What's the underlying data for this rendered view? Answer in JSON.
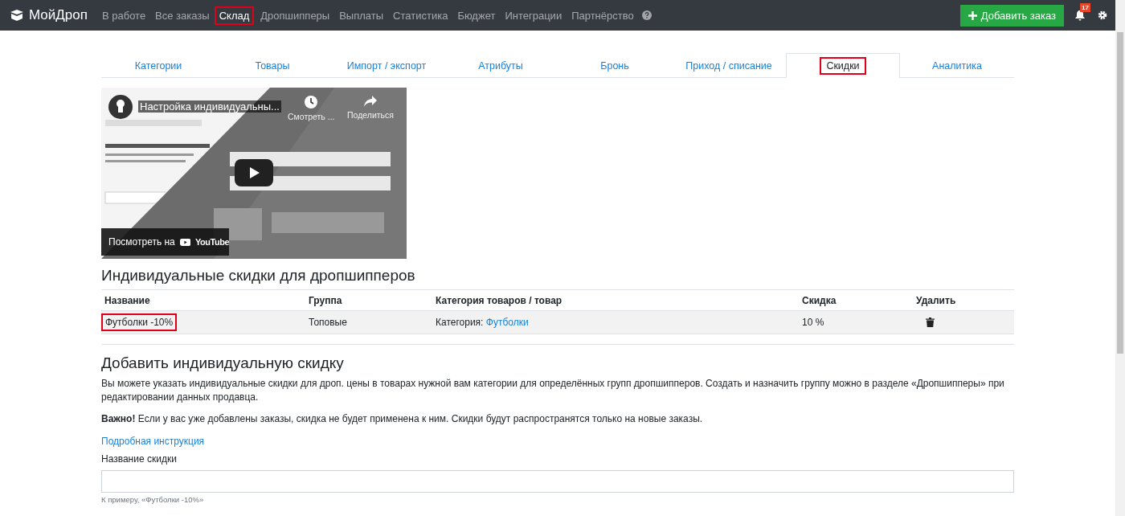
{
  "navbar": {
    "brand": "МойДроп",
    "items": [
      {
        "label": "В работе",
        "selected": false,
        "highlighted": false
      },
      {
        "label": "Все заказы",
        "selected": false,
        "highlighted": false
      },
      {
        "label": "Склад",
        "selected": true,
        "highlighted": true
      },
      {
        "label": "Дропшипперы",
        "selected": false,
        "highlighted": false
      },
      {
        "label": "Выплаты",
        "selected": false,
        "highlighted": false
      },
      {
        "label": "Статистика",
        "selected": false,
        "highlighted": false
      },
      {
        "label": "Бюджет",
        "selected": false,
        "highlighted": false
      },
      {
        "label": "Интеграции",
        "selected": false,
        "highlighted": false
      },
      {
        "label": "Партнёрство",
        "selected": false,
        "highlighted": false
      }
    ],
    "add_button": "Добавить заказ",
    "notifications_count": "17"
  },
  "tabs": [
    {
      "label": "Категории",
      "selected": false,
      "highlighted": false
    },
    {
      "label": "Товары",
      "selected": false,
      "highlighted": false
    },
    {
      "label": "Импорт / экспорт",
      "selected": false,
      "highlighted": false
    },
    {
      "label": "Атрибуты",
      "selected": false,
      "highlighted": false
    },
    {
      "label": "Бронь",
      "selected": false,
      "highlighted": false
    },
    {
      "label": "Приход / списание",
      "selected": false,
      "highlighted": false
    },
    {
      "label": "Скидки",
      "selected": true,
      "highlighted": true
    },
    {
      "label": "Аналитика",
      "selected": false,
      "highlighted": false
    }
  ],
  "video": {
    "kind": "picture",
    "title": "Настройка индивидуальны...",
    "watch_later": "Смотреть ...",
    "share": "Поделиться",
    "watch_on": "Посмотреть на",
    "platform": "YouTube"
  },
  "discounts": {
    "title": "Индивидуальные скидки для дропшипперов",
    "columns": [
      "Название",
      "Группа",
      "Категория товаров / товар",
      "Скидка",
      "Удалить"
    ],
    "rows": [
      {
        "name": "Футболки -10%",
        "highlighted": true,
        "group": "Топовые",
        "category_label": "Категория:",
        "category_link": "Футболки",
        "discount": "10 %"
      }
    ]
  },
  "add_form": {
    "title": "Добавить индивидуальную скидку",
    "description": "Вы можете указать индивидуальные скидки для дроп. цены в товарах нужной вам категории для определённых групп дропшипперов. Создать и назначить группу можно в разделе «Дропшипперы» при редактировании данных продавца.",
    "note": "**Важно!** Если у вас уже добавлены заказы, скидка не будет применена к ним. Скидки будут распространятся только на новые заказы.",
    "link": "Подробная инструкция",
    "field_label": "Название скидки",
    "field_hint": "К примеру, «Футболки -10%»"
  }
}
